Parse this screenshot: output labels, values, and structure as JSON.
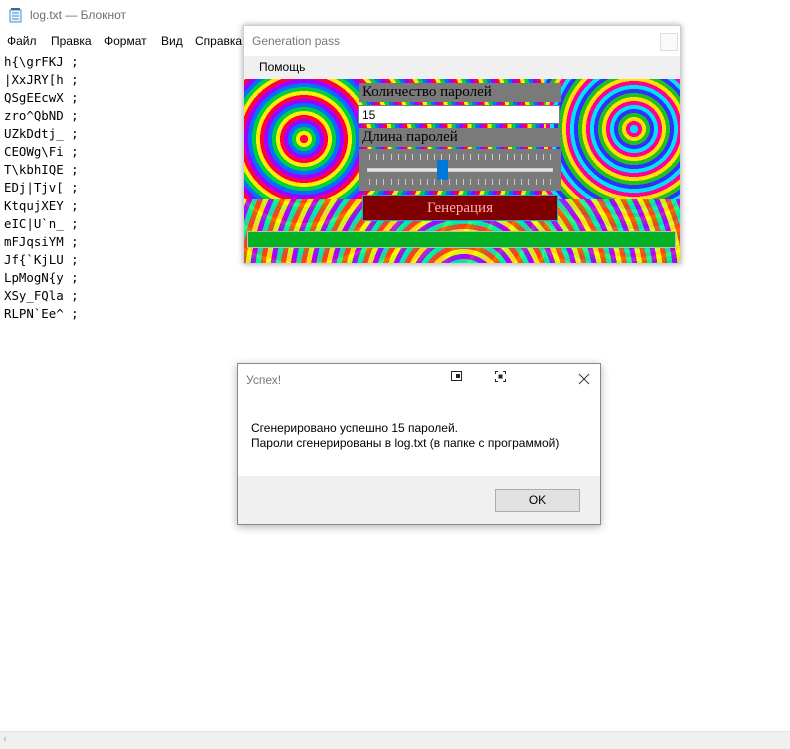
{
  "notepad": {
    "title": "log.txt — Блокнот",
    "menu": [
      "Файл",
      "Правка",
      "Формат",
      "Вид",
      "Справка"
    ],
    "lines": [
      "h{\\grFKJ ;",
      "|XxJRY[h ;",
      "QSgEEcwX ;",
      "zro^QbND ;",
      "UZkDdtj_ ;",
      "CEOWg\\Fi ;",
      "T\\kbhIQE ;",
      "EDj|Tjv[ ;",
      "KtqujXEY ;",
      "eIC|U`n_ ;",
      "mFJqsiYM ;",
      "Jf{`KjLU ;",
      "LpMogN{y ;",
      "XSy_FQla ;",
      "RLPN`Ee^ ;"
    ]
  },
  "gen": {
    "title": "Generation pass",
    "menu_help": "Помощь",
    "count_label": "Количество паролей",
    "count_value": "15",
    "length_label": "Длина паролей",
    "slider_value_fraction": 0.4,
    "slider_tick_count": 26,
    "generate_label": "Генерация",
    "progress_fraction": 1.0,
    "progress_color": "#06b025",
    "generate_bg": "#800000"
  },
  "msg": {
    "title": "Успех!",
    "line1": "Сгенерировано успешно 15 паролей.",
    "line2": "Пароли сгенерированы в log.txt (в папке с программой)",
    "ok_label": "OK"
  }
}
